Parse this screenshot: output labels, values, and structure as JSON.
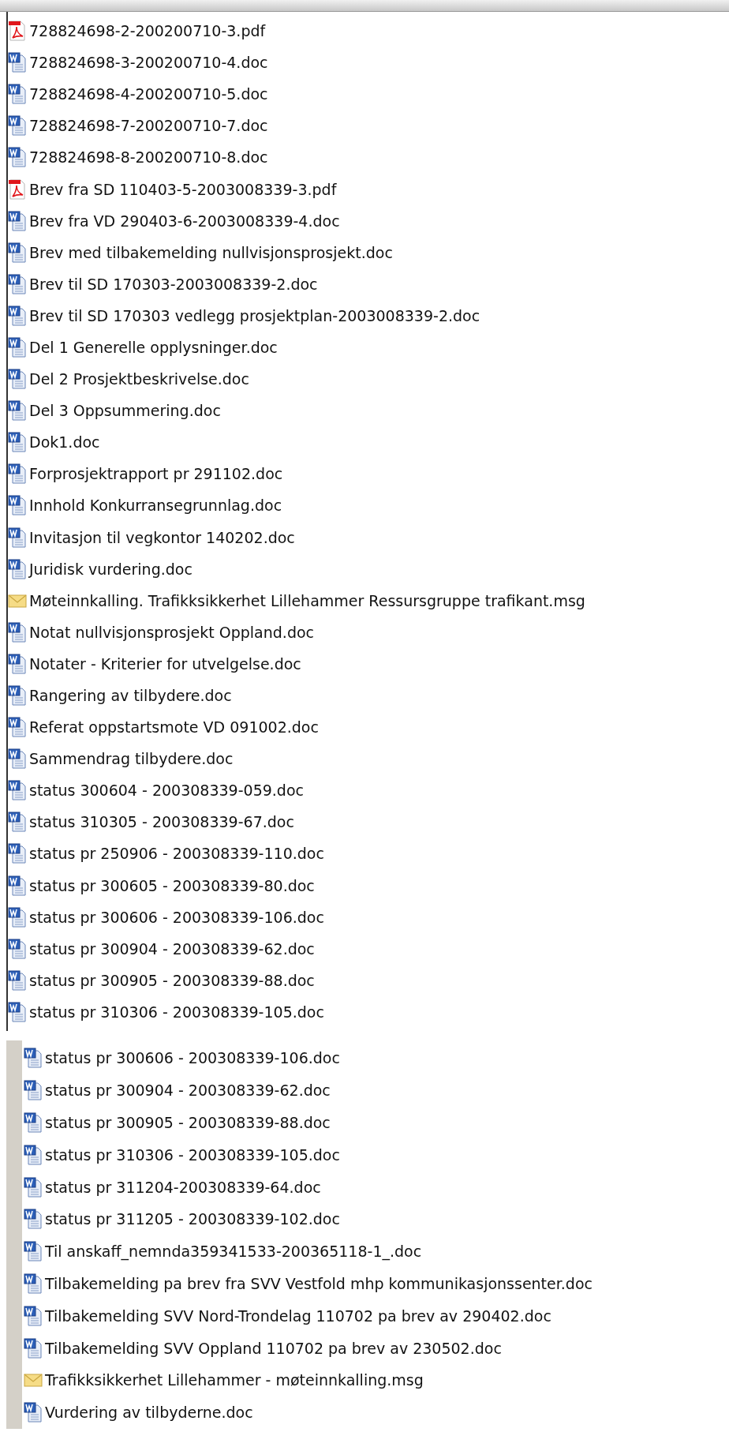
{
  "panels": [
    {
      "files": [
        {
          "kind": "pdf",
          "name": "728824698-2-200200710-3.pdf"
        },
        {
          "kind": "doc",
          "name": "728824698-3-200200710-4.doc"
        },
        {
          "kind": "doc",
          "name": "728824698-4-200200710-5.doc"
        },
        {
          "kind": "doc",
          "name": "728824698-7-200200710-7.doc"
        },
        {
          "kind": "doc",
          "name": "728824698-8-200200710-8.doc"
        },
        {
          "kind": "pdf",
          "name": "Brev fra SD 110403-5-2003008339-3.pdf"
        },
        {
          "kind": "doc",
          "name": "Brev fra VD 290403-6-2003008339-4.doc"
        },
        {
          "kind": "doc",
          "name": "Brev med tilbakemelding nullvisjonsprosjekt.doc"
        },
        {
          "kind": "doc",
          "name": "Brev til SD 170303-2003008339-2.doc"
        },
        {
          "kind": "doc",
          "name": "Brev til SD 170303 vedlegg prosjektplan-2003008339-2.doc"
        },
        {
          "kind": "doc",
          "name": "Del 1 Generelle opplysninger.doc"
        },
        {
          "kind": "doc",
          "name": "Del 2 Prosjektbeskrivelse.doc"
        },
        {
          "kind": "doc",
          "name": "Del 3 Oppsummering.doc"
        },
        {
          "kind": "doc",
          "name": "Dok1.doc"
        },
        {
          "kind": "doc",
          "name": "Forprosjektrapport pr 291102.doc"
        },
        {
          "kind": "doc",
          "name": "Innhold Konkurransegrunnlag.doc"
        },
        {
          "kind": "doc",
          "name": "Invitasjon til vegkontor 140202.doc"
        },
        {
          "kind": "doc",
          "name": "Juridisk vurdering.doc"
        },
        {
          "kind": "msg",
          "name": "Møteinnkalling.  Trafikksikkerhet Lillehammer Ressursgruppe trafikant.msg"
        },
        {
          "kind": "doc",
          "name": "Notat nullvisjonsprosjekt Oppland.doc"
        },
        {
          "kind": "doc",
          "name": "Notater - Kriterier for utvelgelse.doc"
        },
        {
          "kind": "doc",
          "name": "Rangering av tilbydere.doc"
        },
        {
          "kind": "doc",
          "name": "Referat oppstartsmote VD 091002.doc"
        },
        {
          "kind": "doc",
          "name": "Sammendrag tilbydere.doc"
        },
        {
          "kind": "doc",
          "name": "status 300604 - 200308339-059.doc"
        },
        {
          "kind": "doc",
          "name": "status 310305 - 200308339-67.doc"
        },
        {
          "kind": "doc",
          "name": "status pr 250906 - 200308339-110.doc"
        },
        {
          "kind": "doc",
          "name": "status pr 300605 - 200308339-80.doc"
        },
        {
          "kind": "doc",
          "name": "status pr 300606 - 200308339-106.doc"
        },
        {
          "kind": "doc",
          "name": "status pr 300904 - 200308339-62.doc"
        },
        {
          "kind": "doc",
          "name": "status pr 300905 - 200308339-88.doc"
        },
        {
          "kind": "doc",
          "name": "status pr 310306 - 200308339-105.doc"
        }
      ]
    },
    {
      "files": [
        {
          "kind": "doc",
          "name": "status pr 300606 - 200308339-106.doc"
        },
        {
          "kind": "doc",
          "name": "status pr 300904 - 200308339-62.doc"
        },
        {
          "kind": "doc",
          "name": "status pr 300905 - 200308339-88.doc"
        },
        {
          "kind": "doc",
          "name": "status pr 310306 - 200308339-105.doc"
        },
        {
          "kind": "doc",
          "name": "status pr 311204-200308339-64.doc"
        },
        {
          "kind": "doc",
          "name": "status pr 311205 - 200308339-102.doc"
        },
        {
          "kind": "doc",
          "name": "Til anskaff_nemnda359341533-200365118-1_.doc"
        },
        {
          "kind": "doc",
          "name": "Tilbakemelding pa brev fra SVV Vestfold mhp kommunikasjonssenter.doc"
        },
        {
          "kind": "doc",
          "name": "Tilbakemelding SVV Nord-Trondelag 110702 pa brev av 290402.doc"
        },
        {
          "kind": "doc",
          "name": "Tilbakemelding SVV Oppland 110702 pa brev av 230502.doc"
        },
        {
          "kind": "msg",
          "name": "Trafikksikkerhet Lillehammer - møteinnkalling.msg"
        },
        {
          "kind": "doc",
          "name": "Vurdering av tilbyderne.doc"
        }
      ]
    }
  ]
}
